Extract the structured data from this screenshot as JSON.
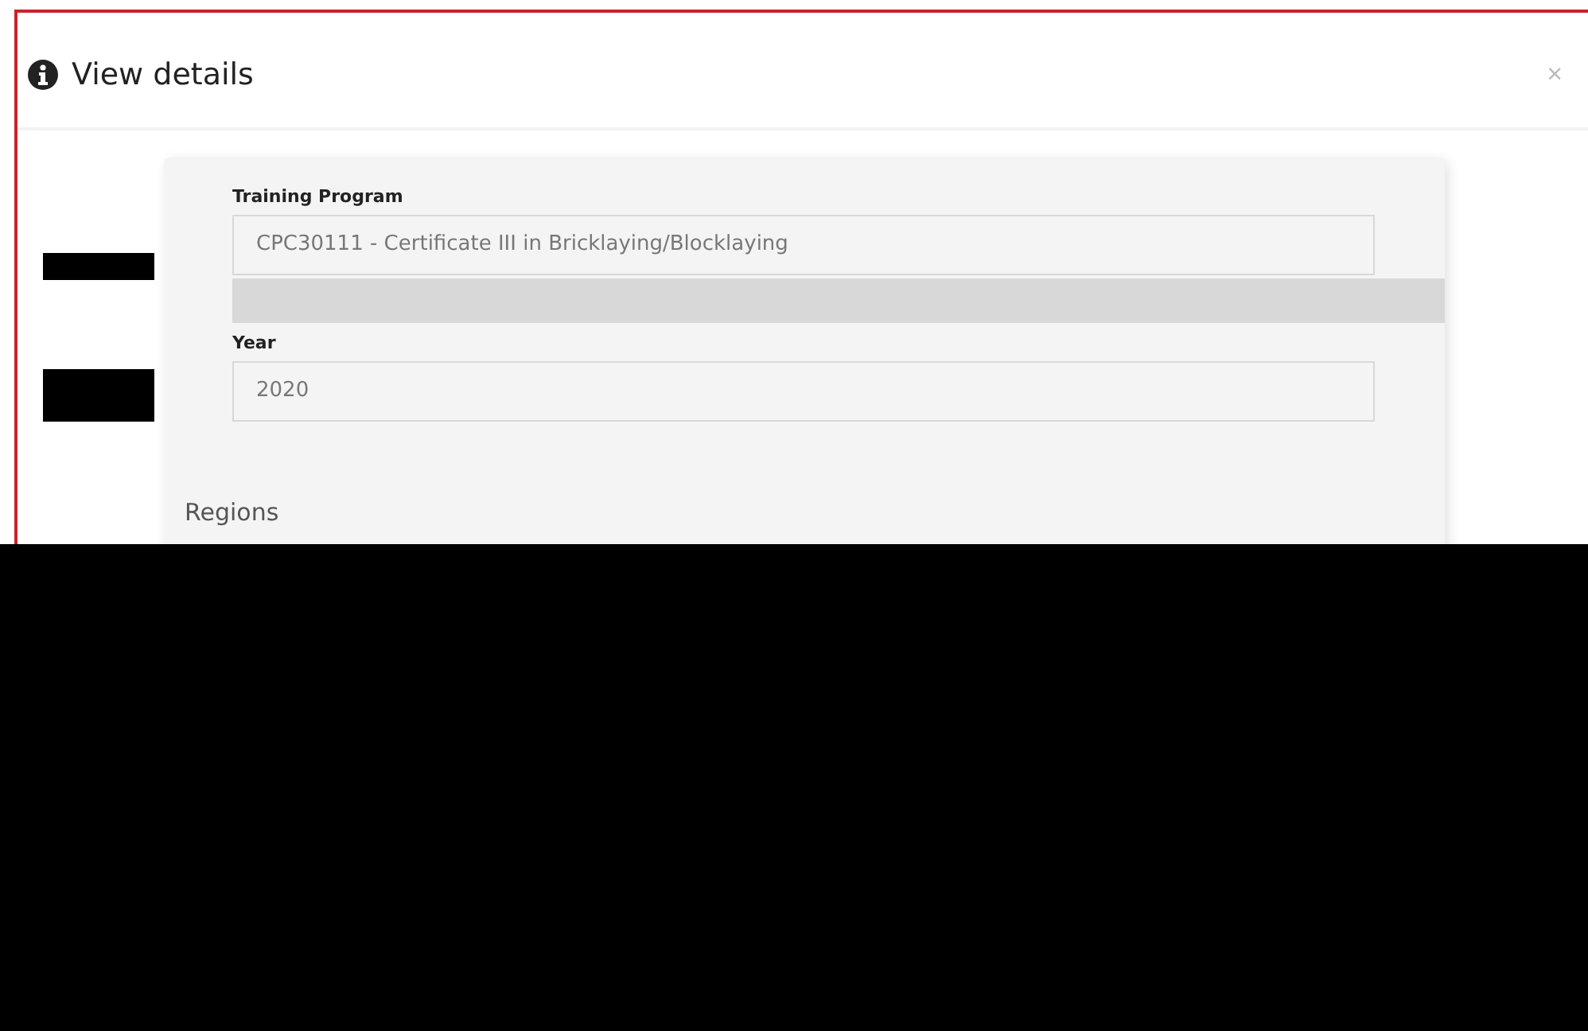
{
  "dialog": {
    "title": "View details",
    "close": "×"
  },
  "fields": [
    {
      "label": "Training Program",
      "value": "CPC30111 - Certificate III in Bricklaying/Blocklaying"
    },
    {
      "label": "Year",
      "value": "2020"
    }
  ],
  "section": {
    "heading": "Regions"
  }
}
